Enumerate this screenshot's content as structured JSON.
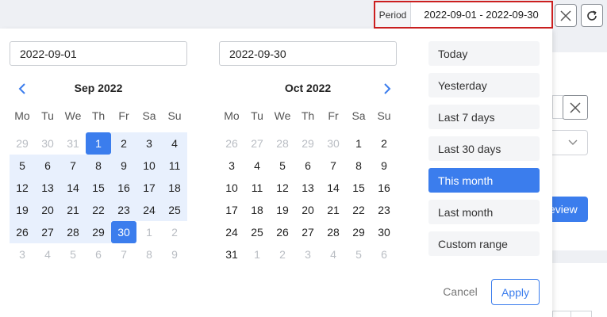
{
  "period": {
    "label": "Period",
    "value": "2022-09-01 - 2022-09-30"
  },
  "icons": {
    "clear": "close-icon",
    "refresh": "refresh-icon",
    "prev": "chevron-left-icon",
    "next": "chevron-right-icon"
  },
  "colors": {
    "accent": "#3b7ded",
    "range_fill": "#e8f0fd",
    "highlight_border": "#cc1f1f"
  },
  "inputs": {
    "start_date": "2022-09-01",
    "end_date": "2022-09-30"
  },
  "weekdays": [
    "Mo",
    "Tu",
    "We",
    "Th",
    "Fr",
    "Sa",
    "Su"
  ],
  "calendars": [
    {
      "title": "Sep 2022",
      "days": [
        {
          "d": "29",
          "s": "off"
        },
        {
          "d": "30",
          "s": "off"
        },
        {
          "d": "31",
          "s": "off"
        },
        {
          "d": "1",
          "s": "start"
        },
        {
          "d": "2",
          "s": "range"
        },
        {
          "d": "3",
          "s": "range"
        },
        {
          "d": "4",
          "s": "range"
        },
        {
          "d": "5",
          "s": "range"
        },
        {
          "d": "6",
          "s": "range"
        },
        {
          "d": "7",
          "s": "range"
        },
        {
          "d": "8",
          "s": "range"
        },
        {
          "d": "9",
          "s": "range"
        },
        {
          "d": "10",
          "s": "range"
        },
        {
          "d": "11",
          "s": "range"
        },
        {
          "d": "12",
          "s": "range"
        },
        {
          "d": "13",
          "s": "range"
        },
        {
          "d": "14",
          "s": "range"
        },
        {
          "d": "15",
          "s": "range"
        },
        {
          "d": "16",
          "s": "range"
        },
        {
          "d": "17",
          "s": "range"
        },
        {
          "d": "18",
          "s": "range"
        },
        {
          "d": "19",
          "s": "range"
        },
        {
          "d": "20",
          "s": "range"
        },
        {
          "d": "21",
          "s": "range"
        },
        {
          "d": "22",
          "s": "range"
        },
        {
          "d": "23",
          "s": "range"
        },
        {
          "d": "24",
          "s": "range"
        },
        {
          "d": "25",
          "s": "range"
        },
        {
          "d": "26",
          "s": "range"
        },
        {
          "d": "27",
          "s": "range"
        },
        {
          "d": "28",
          "s": "range"
        },
        {
          "d": "29",
          "s": "range"
        },
        {
          "d": "30",
          "s": "end"
        },
        {
          "d": "1",
          "s": "off"
        },
        {
          "d": "2",
          "s": "off"
        },
        {
          "d": "3",
          "s": "off"
        },
        {
          "d": "4",
          "s": "off"
        },
        {
          "d": "5",
          "s": "off"
        },
        {
          "d": "6",
          "s": "off"
        },
        {
          "d": "7",
          "s": "off"
        },
        {
          "d": "8",
          "s": "off"
        },
        {
          "d": "9",
          "s": "off"
        }
      ]
    },
    {
      "title": "Oct 2022",
      "days": [
        {
          "d": "26",
          "s": "off"
        },
        {
          "d": "27",
          "s": "off"
        },
        {
          "d": "28",
          "s": "off"
        },
        {
          "d": "29",
          "s": "off"
        },
        {
          "d": "30",
          "s": "off"
        },
        {
          "d": "1",
          "s": "normal"
        },
        {
          "d": "2",
          "s": "normal"
        },
        {
          "d": "3",
          "s": "normal"
        },
        {
          "d": "4",
          "s": "normal"
        },
        {
          "d": "5",
          "s": "normal"
        },
        {
          "d": "6",
          "s": "normal"
        },
        {
          "d": "7",
          "s": "normal"
        },
        {
          "d": "8",
          "s": "normal"
        },
        {
          "d": "9",
          "s": "normal"
        },
        {
          "d": "10",
          "s": "normal"
        },
        {
          "d": "11",
          "s": "normal"
        },
        {
          "d": "12",
          "s": "normal"
        },
        {
          "d": "13",
          "s": "normal"
        },
        {
          "d": "14",
          "s": "normal"
        },
        {
          "d": "15",
          "s": "normal"
        },
        {
          "d": "16",
          "s": "normal"
        },
        {
          "d": "17",
          "s": "normal"
        },
        {
          "d": "18",
          "s": "normal"
        },
        {
          "d": "19",
          "s": "normal"
        },
        {
          "d": "20",
          "s": "normal"
        },
        {
          "d": "21",
          "s": "normal"
        },
        {
          "d": "22",
          "s": "normal"
        },
        {
          "d": "23",
          "s": "normal"
        },
        {
          "d": "24",
          "s": "normal"
        },
        {
          "d": "25",
          "s": "normal"
        },
        {
          "d": "26",
          "s": "normal"
        },
        {
          "d": "27",
          "s": "normal"
        },
        {
          "d": "28",
          "s": "normal"
        },
        {
          "d": "29",
          "s": "normal"
        },
        {
          "d": "30",
          "s": "normal"
        },
        {
          "d": "31",
          "s": "normal"
        },
        {
          "d": "1",
          "s": "off"
        },
        {
          "d": "2",
          "s": "off"
        },
        {
          "d": "3",
          "s": "off"
        },
        {
          "d": "4",
          "s": "off"
        },
        {
          "d": "5",
          "s": "off"
        },
        {
          "d": "6",
          "s": "off"
        }
      ]
    }
  ],
  "ranges": [
    {
      "label": "Today",
      "selected": false
    },
    {
      "label": "Yesterday",
      "selected": false
    },
    {
      "label": "Last 7 days",
      "selected": false
    },
    {
      "label": "Last 30 days",
      "selected": false
    },
    {
      "label": "This month",
      "selected": true
    },
    {
      "label": "Last month",
      "selected": false
    },
    {
      "label": "Custom range",
      "selected": false
    }
  ],
  "actions": {
    "cancel": "Cancel",
    "apply": "Apply"
  },
  "background": {
    "button_fragment": "eview"
  }
}
